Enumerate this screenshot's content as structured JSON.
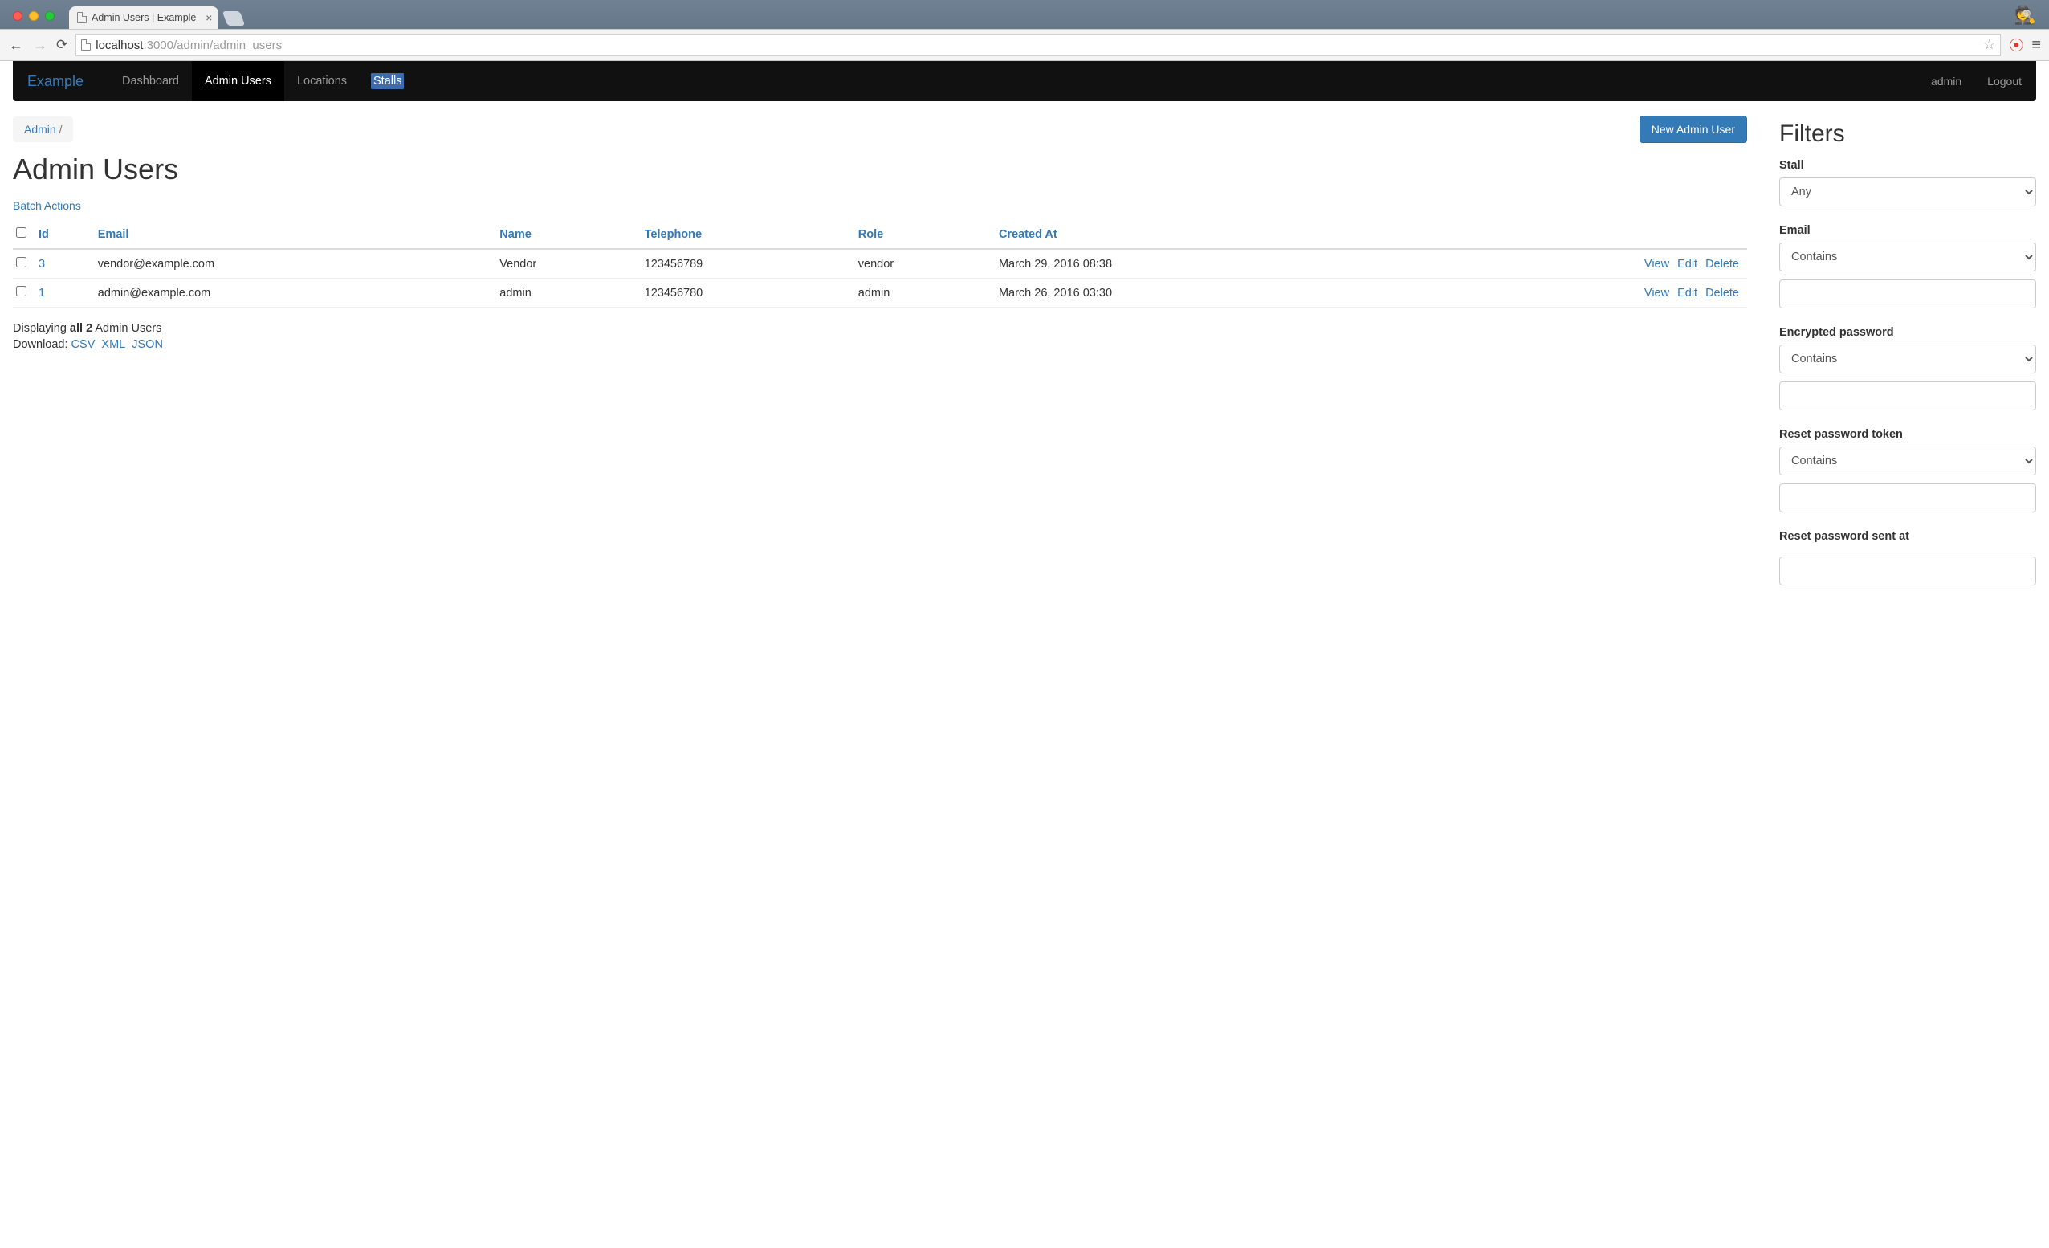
{
  "browser": {
    "tab_title": "Admin Users | Example",
    "url_host": "localhost",
    "url_port": ":3000",
    "url_path": "/admin/admin_users"
  },
  "nav": {
    "brand": "Example",
    "links": [
      "Dashboard",
      "Admin Users",
      "Locations",
      "Stalls"
    ],
    "active_index": 1,
    "highlight_index": 3,
    "right": {
      "user": "admin",
      "logout": "Logout"
    }
  },
  "breadcrumb": {
    "link": "Admin",
    "sep": " / "
  },
  "new_button": "New Admin User",
  "page_title": "Admin Users",
  "batch_actions": "Batch Actions",
  "columns": [
    "Id",
    "Email",
    "Name",
    "Telephone",
    "Role",
    "Created At"
  ],
  "rows": [
    {
      "id": "3",
      "email": "vendor@example.com",
      "name": "Vendor",
      "telephone": "123456789",
      "role": "vendor",
      "created_at": "March 29, 2016 08:38"
    },
    {
      "id": "1",
      "email": "admin@example.com",
      "name": "admin",
      "telephone": "123456780",
      "role": "admin",
      "created_at": "March 26, 2016 03:30"
    }
  ],
  "row_actions": {
    "view": "View",
    "edit": "Edit",
    "delete": "Delete"
  },
  "summary": {
    "prefix": "Displaying ",
    "bold": "all 2",
    "suffix": " Admin Users"
  },
  "download": {
    "label": "Download:",
    "csv": "CSV",
    "xml": "XML",
    "json": "JSON"
  },
  "filters": {
    "title": "Filters",
    "groups": [
      {
        "label": "Stall",
        "select": "Any",
        "has_text": false
      },
      {
        "label": "Email",
        "select": "Contains",
        "has_text": true
      },
      {
        "label": "Encrypted password",
        "select": "Contains",
        "has_text": true
      },
      {
        "label": "Reset password token",
        "select": "Contains",
        "has_text": true
      },
      {
        "label": "Reset password sent at",
        "select": "",
        "has_text": true
      }
    ]
  }
}
